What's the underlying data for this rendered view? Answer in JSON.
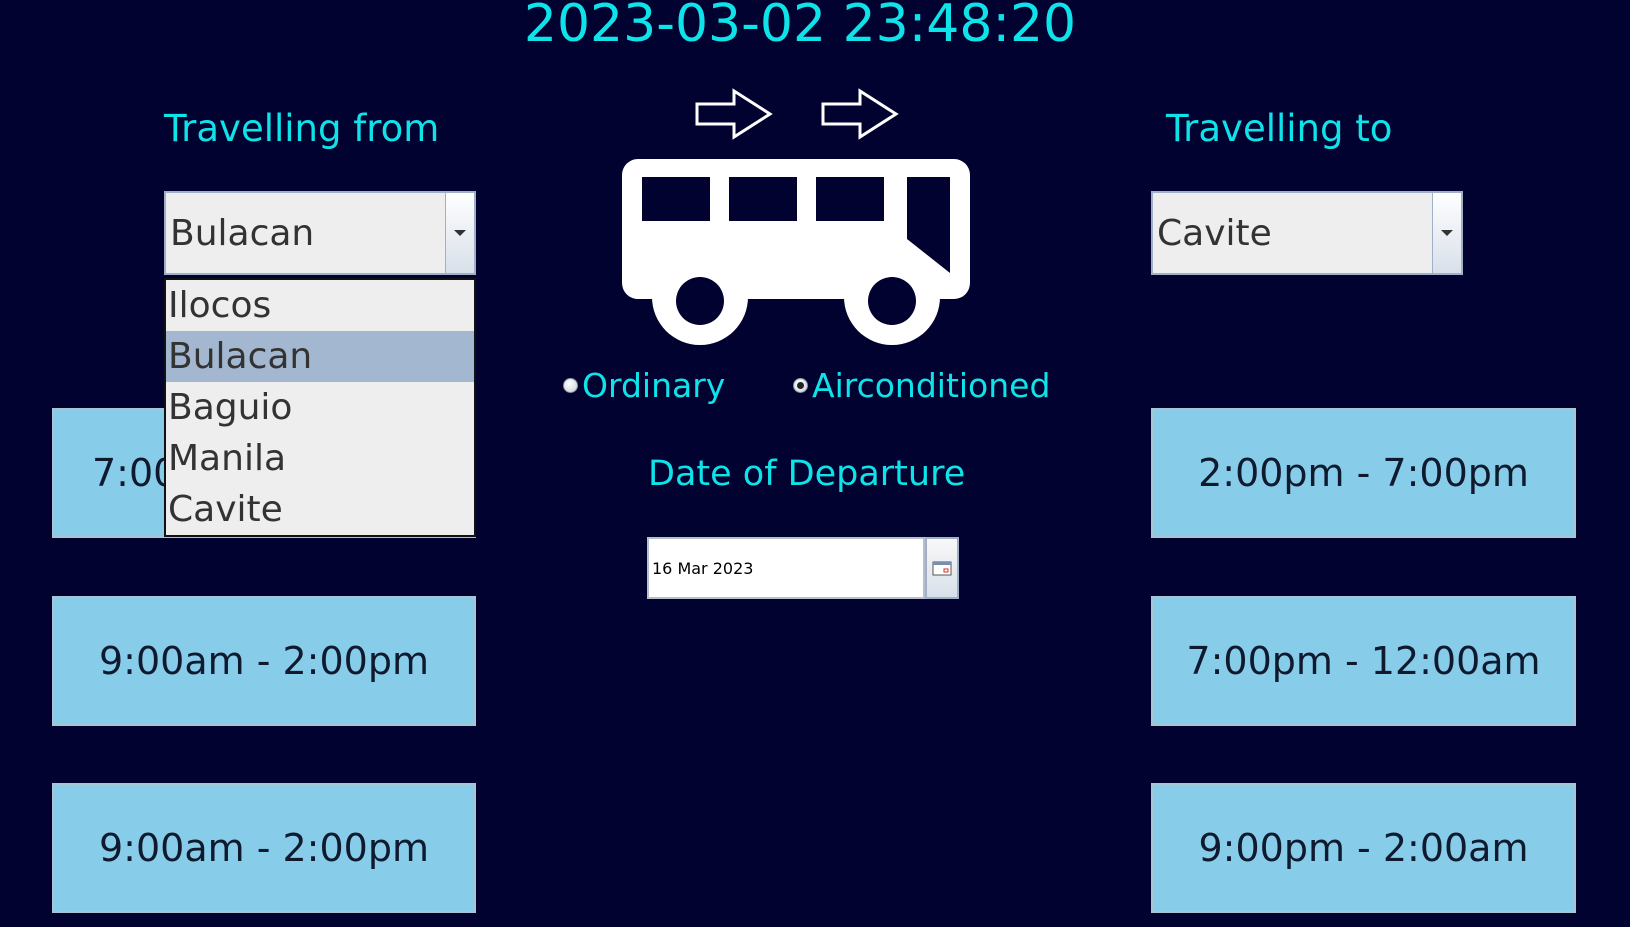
{
  "clock": "2023-03-02 23:48:20",
  "origin": {
    "heading": "Travelling from",
    "selected": "Bulacan",
    "dropdown_open": true,
    "options": [
      "Ilocos",
      "Bulacan",
      "Baguio",
      "Manila",
      "Cavite"
    ],
    "highlighted_index": 1
  },
  "destination": {
    "heading": "Travelling to",
    "selected": "Cavite"
  },
  "bus_type": {
    "ordinary_label": "Ordinary",
    "aircon_label": "Airconditioned",
    "selected": "Airconditioned"
  },
  "departure": {
    "heading": "Date of Departure",
    "date": "16 Mar 2023"
  },
  "left_slots": [
    "7:00",
    "9:00am - 2:00pm",
    "9:00am - 2:00pm"
  ],
  "right_slots": [
    "2:00pm - 7:00pm",
    "7:00pm - 12:00am",
    "9:00pm - 2:00am"
  ],
  "icons": {
    "bus": "bus-icon",
    "arrows": "right-arrow-outline-icon",
    "calendar": "calendar-icon",
    "dropdown": "chevron-down-icon"
  },
  "colors": {
    "background": "#020230",
    "accent_text": "#0fe3ea",
    "slot_button": "#87cdea",
    "selected_option": "#a3b8d0"
  }
}
